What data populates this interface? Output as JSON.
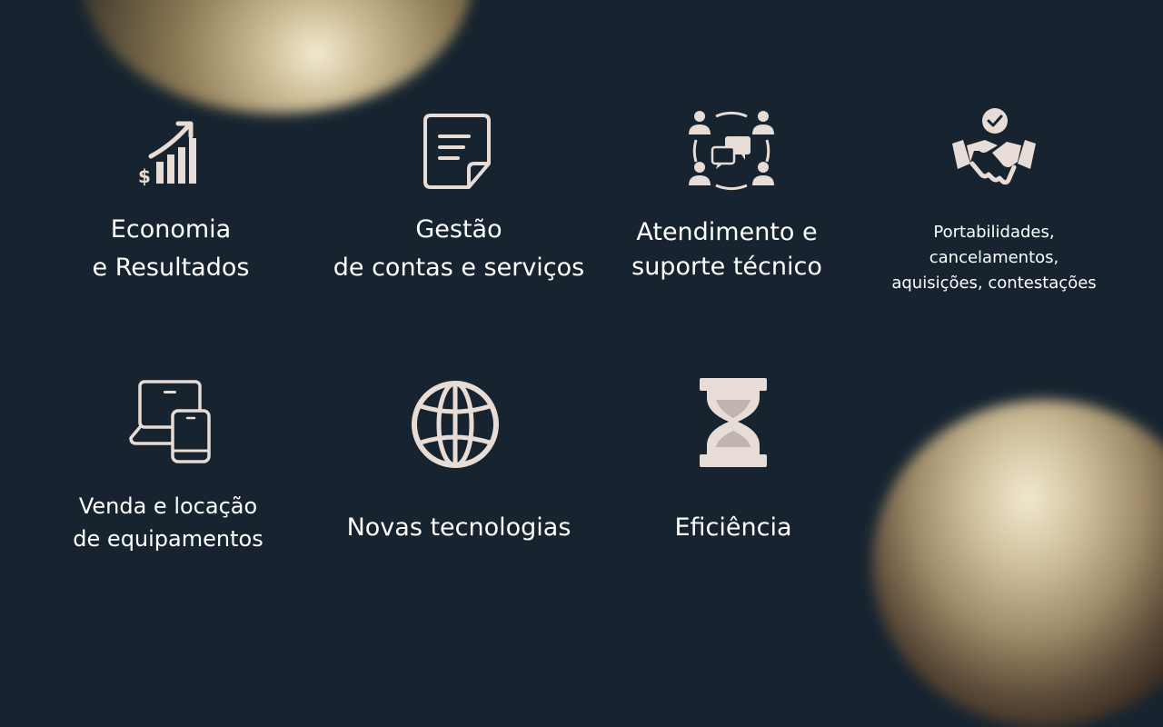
{
  "colors": {
    "background": "#172430",
    "icon": "#e8ddd6",
    "text": "#ffffff"
  },
  "features": [
    {
      "icon": "revenue-growth-chart-icon",
      "line1": "Economia",
      "line2": "e Resultados"
    },
    {
      "icon": "document-icon",
      "line1": "Gestão",
      "line2": "de contas e serviços"
    },
    {
      "icon": "team-chat-support-icon",
      "line1": "Atendimento e",
      "line2": "suporte técnico"
    },
    {
      "icon": "handshake-check-icon",
      "line1": "Portabilidades,",
      "line2": "cancelamentos,",
      "line3": "aquisições, contestações"
    },
    {
      "icon": "laptop-phone-devices-icon",
      "line1": "Venda e locação",
      "line2": "de equipamentos"
    },
    {
      "icon": "globe-icon",
      "line1": "Novas tecnologias"
    },
    {
      "icon": "hourglass-icon",
      "line1": "Eficiência"
    }
  ]
}
